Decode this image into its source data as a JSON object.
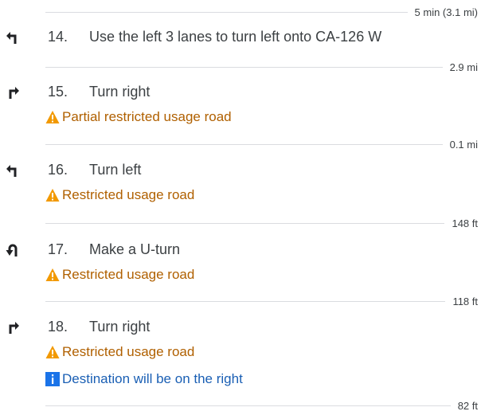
{
  "top_distance": "5 min (3.1 mi)",
  "steps": [
    {
      "number": "14.",
      "instruction": "Use the left 3 lanes to turn left onto CA-126 W",
      "maneuver_icon": "turn-left-icon",
      "distance_after": "2.9 mi"
    },
    {
      "number": "15.",
      "instruction": "Turn right",
      "maneuver_icon": "turn-right-icon",
      "warning": "Partial restricted usage road",
      "distance_after": "0.1 mi"
    },
    {
      "number": "16.",
      "instruction": "Turn left",
      "maneuver_icon": "turn-left-icon",
      "warning": "Restricted usage road",
      "distance_after": "148 ft"
    },
    {
      "number": "17.",
      "instruction": "Make a U-turn",
      "maneuver_icon": "u-turn-icon",
      "warning": "Restricted usage road",
      "distance_after": "118 ft"
    },
    {
      "number": "18.",
      "instruction": "Turn right",
      "maneuver_icon": "turn-right-icon",
      "warning": "Restricted usage road",
      "info": "Destination will be on the right",
      "distance_after": "82 ft"
    }
  ],
  "colors": {
    "warning_text": "#b06000",
    "warning_icon": "#f29900",
    "info_text": "#1a5fb4",
    "info_icon": "#1a73e8",
    "divider": "#dadce0"
  }
}
